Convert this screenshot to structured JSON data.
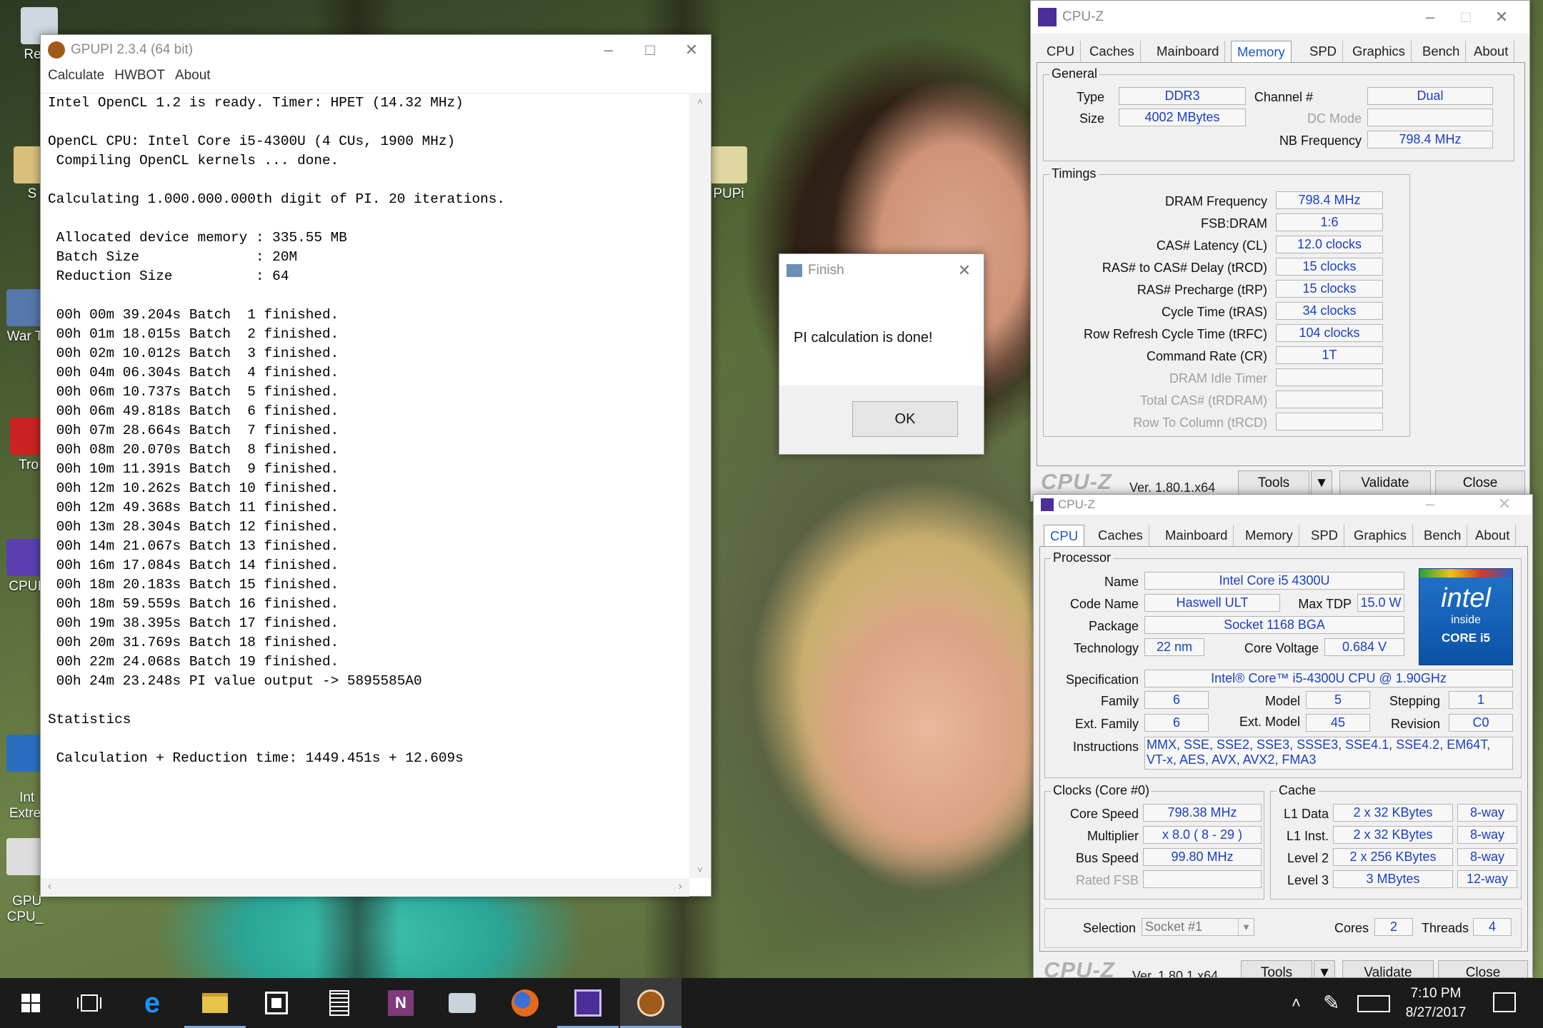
{
  "desktop": {
    "icons": [
      {
        "label": "Recy",
        "color": "#cfd8e0"
      },
      {
        "label": "S",
        "color": "#d9c07a"
      },
      {
        "label": "War T",
        "color": "#5577aa"
      },
      {
        "label": "Tro",
        "color": "#cc2222"
      },
      {
        "label": "CPUI",
        "color": "#5b3fb0"
      },
      {
        "label": "Int\nExtre",
        "color": "#2a6fbf"
      },
      {
        "label": "GPU\nCPU_",
        "color": "#dddddd"
      },
      {
        "label": "PUPi",
        "color": "#e0d6a0"
      }
    ]
  },
  "gpupi": {
    "title": "GPUPI 2.3.4 (64 bit)",
    "menu": [
      "Calculate",
      "HWBOT",
      "About"
    ],
    "lines": [
      "Intel OpenCL 1.2 is ready. Timer: HPET (14.32 MHz)",
      "",
      "OpenCL CPU: Intel Core i5-4300U (4 CUs, 1900 MHz)",
      " Compiling OpenCL kernels ... done.",
      "",
      "Calculating 1.000.000.000th digit of PI. 20 iterations.",
      "",
      " Allocated device memory : 335.55 MB",
      " Batch Size              : 20M",
      " Reduction Size          : 64",
      "",
      " 00h 00m 39.204s Batch  1 finished.",
      " 00h 01m 18.015s Batch  2 finished.",
      " 00h 02m 10.012s Batch  3 finished.",
      " 00h 04m 06.304s Batch  4 finished.",
      " 00h 06m 10.737s Batch  5 finished.",
      " 00h 06m 49.818s Batch  6 finished.",
      " 00h 07m 28.664s Batch  7 finished.",
      " 00h 08m 20.070s Batch  8 finished.",
      " 00h 10m 11.391s Batch  9 finished.",
      " 00h 12m 10.262s Batch 10 finished.",
      " 00h 12m 49.368s Batch 11 finished.",
      " 00h 13m 28.304s Batch 12 finished.",
      " 00h 14m 21.067s Batch 13 finished.",
      " 00h 16m 17.084s Batch 14 finished.",
      " 00h 18m 20.183s Batch 15 finished.",
      " 00h 18m 59.559s Batch 16 finished.",
      " 00h 19m 38.395s Batch 17 finished.",
      " 00h 20m 31.769s Batch 18 finished.",
      " 00h 22m 24.068s Batch 19 finished.",
      " 00h 24m 23.248s PI value output -> 5895585A0",
      "",
      "Statistics",
      "",
      " Calculation + Reduction time: 1449.451s + 12.609s"
    ]
  },
  "finish": {
    "title": "Finish",
    "message": "PI calculation is done!",
    "ok": "OK"
  },
  "cpuz_mem": {
    "title": "CPU-Z",
    "tabs": [
      "CPU",
      "Caches",
      "Mainboard",
      "Memory",
      "SPD",
      "Graphics",
      "Bench",
      "About"
    ],
    "general": {
      "label": "General",
      "type_label": "Type",
      "type": "DDR3",
      "size_label": "Size",
      "size": "4002 MBytes",
      "channel_label": "Channel #",
      "channel": "Dual",
      "dcmode_label": "DC Mode",
      "dcmode": "",
      "nbfreq_label": "NB Frequency",
      "nbfreq": "798.4 MHz"
    },
    "timings": {
      "label": "Timings",
      "rows": [
        {
          "label": "DRAM Frequency",
          "value": "798.4 MHz",
          "dim": false
        },
        {
          "label": "FSB:DRAM",
          "value": "1:6",
          "dim": false
        },
        {
          "label": "CAS# Latency (CL)",
          "value": "12.0 clocks",
          "dim": false
        },
        {
          "label": "RAS# to CAS# Delay (tRCD)",
          "value": "15 clocks",
          "dim": false
        },
        {
          "label": "RAS# Precharge (tRP)",
          "value": "15 clocks",
          "dim": false
        },
        {
          "label": "Cycle Time (tRAS)",
          "value": "34 clocks",
          "dim": false
        },
        {
          "label": "Row Refresh Cycle Time (tRFC)",
          "value": "104 clocks",
          "dim": false
        },
        {
          "label": "Command Rate (CR)",
          "value": "1T",
          "dim": false
        },
        {
          "label": "DRAM Idle Timer",
          "value": "",
          "dim": true
        },
        {
          "label": "Total CAS# (tRDRAM)",
          "value": "",
          "dim": true
        },
        {
          "label": "Row To Column (tRCD)",
          "value": "",
          "dim": true
        }
      ]
    },
    "footer": {
      "logo": "CPU-Z",
      "version": "Ver. 1.80.1.x64",
      "tools": "Tools",
      "validate": "Validate",
      "close": "Close"
    }
  },
  "cpuz_cpu": {
    "title": "CPU-Z",
    "tabs": [
      "CPU",
      "Caches",
      "Mainboard",
      "Memory",
      "SPD",
      "Graphics",
      "Bench",
      "About"
    ],
    "processor": {
      "label": "Processor",
      "name_label": "Name",
      "name": "Intel Core i5 4300U",
      "codename_label": "Code Name",
      "codename": "Haswell ULT",
      "maxtdp_label": "Max TDP",
      "maxtdp": "15.0 W",
      "package_label": "Package",
      "package": "Socket 1168 BGA",
      "tech_label": "Technology",
      "tech": "22 nm",
      "voltage_label": "Core Voltage",
      "voltage": "0.684 V",
      "spec_label": "Specification",
      "spec": "Intel® Core™ i5-4300U CPU @ 1.90GHz",
      "family_label": "Family",
      "family": "6",
      "model_label": "Model",
      "model": "5",
      "stepping_label": "Stepping",
      "stepping": "1",
      "extfamily_label": "Ext. Family",
      "extfamily": "6",
      "extmodel_label": "Ext. Model",
      "extmodel": "45",
      "revision_label": "Revision",
      "revision": "C0",
      "instr_label": "Instructions",
      "instr": "MMX, SSE, SSE2, SSE3, SSSE3, SSE4.1, SSE4.2, EM64T, VT-x, AES, AVX, AVX2, FMA3"
    },
    "intel_logo": {
      "brand": "intel",
      "inside": "inside",
      "core": "CORE i5"
    },
    "clocks": {
      "label": "Clocks (Core #0)",
      "core_speed_label": "Core Speed",
      "core_speed": "798.38 MHz",
      "mult_label": "Multiplier",
      "mult": "x 8.0 ( 8 - 29 )",
      "bus_label": "Bus Speed",
      "bus": "99.80 MHz",
      "fsb_label": "Rated FSB",
      "fsb": ""
    },
    "cache": {
      "label": "Cache",
      "rows": [
        {
          "label": "L1 Data",
          "size": "2 x 32 KBytes",
          "way": "8-way"
        },
        {
          "label": "L1 Inst.",
          "size": "2 x 32 KBytes",
          "way": "8-way"
        },
        {
          "label": "Level 2",
          "size": "2 x 256 KBytes",
          "way": "8-way"
        },
        {
          "label": "Level 3",
          "size": "3 MBytes",
          "way": "12-way"
        }
      ]
    },
    "selection": {
      "label": "Selection",
      "value": "Socket #1",
      "cores_label": "Cores",
      "cores": "2",
      "threads_label": "Threads",
      "threads": "4"
    },
    "footer": {
      "logo": "CPU-Z",
      "version": "Ver. 1.80.1.x64",
      "tools": "Tools",
      "validate": "Validate",
      "close": "Close"
    }
  },
  "taskbar": {
    "time": "7:10 PM",
    "date": "8/27/2017"
  }
}
